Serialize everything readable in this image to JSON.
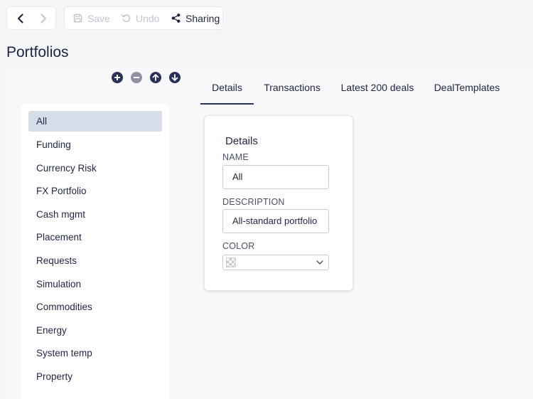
{
  "nav": {
    "back_icon": "chevron-left-icon",
    "forward_icon": "chevron-right-icon"
  },
  "toolbar": {
    "save_label": "Save",
    "undo_label": "Undo",
    "sharing_label": "Sharing"
  },
  "page": {
    "title": "Portfolios"
  },
  "actions": [
    "plus-circle-icon",
    "minus-circle-icon",
    "arrow-up-circle-icon",
    "arrow-down-circle-icon"
  ],
  "portfolios": [
    "All",
    "Funding",
    "Currency Risk",
    "FX Portfolio",
    "Cash mgmt",
    "Placement",
    "Requests",
    "Simulation",
    "Commodities",
    "Energy",
    "System temp",
    "Property"
  ],
  "selected_portfolio": "All",
  "tabs": [
    "Details",
    "Transactions",
    "Latest 200 deals",
    "DealTemplates"
  ],
  "active_tab": "Details",
  "details": {
    "heading": "Details",
    "name_label": "NAME",
    "name_value": "All",
    "description_label": "DESCRIPTION",
    "description_value": "All-standard portfolio",
    "color_label": "COLOR"
  },
  "colors": {
    "accent": "#2a3158",
    "selected_bg": "#d4dde8",
    "disabled": "#c3c6cf"
  }
}
